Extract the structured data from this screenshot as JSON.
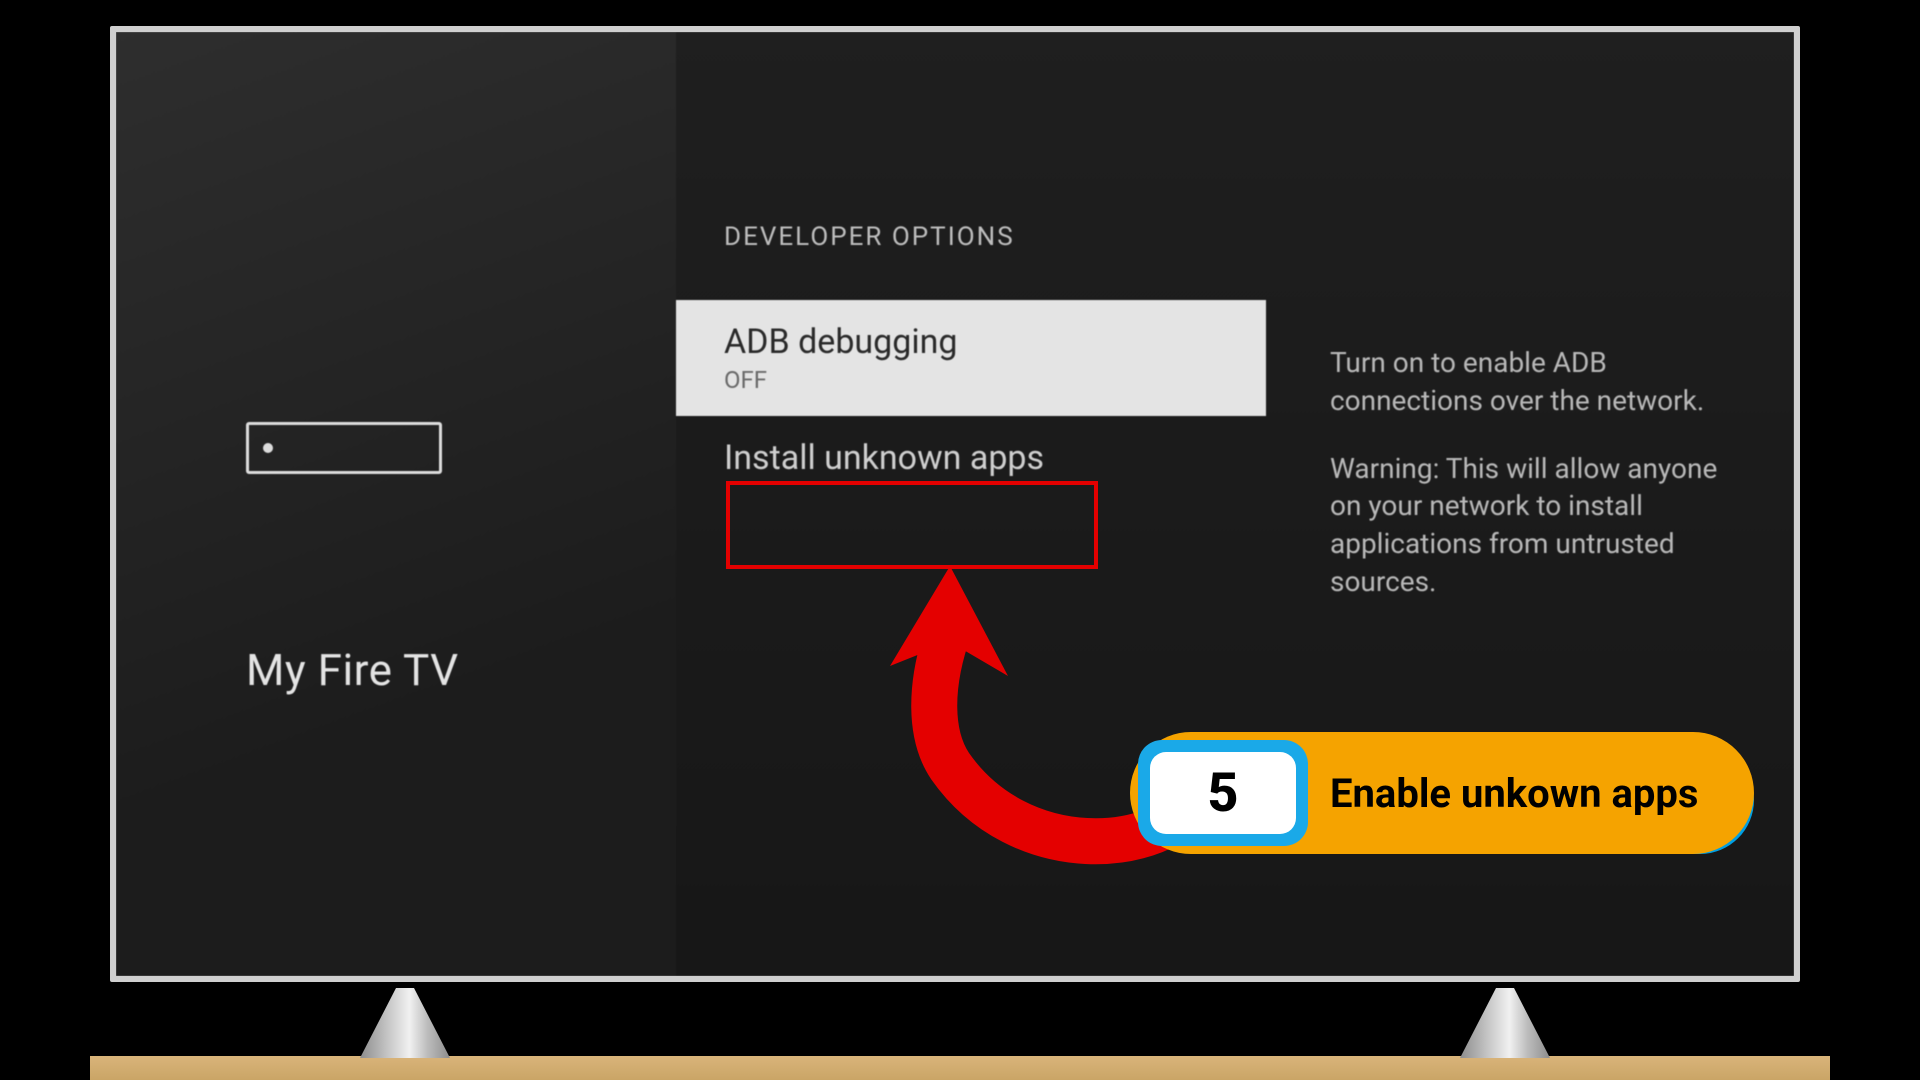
{
  "left": {
    "title": "My Fire TV"
  },
  "mid": {
    "header": "DEVELOPER OPTIONS",
    "options": [
      {
        "label": "ADB debugging",
        "sub": "OFF",
        "selected": true
      },
      {
        "label": "Install unknown apps",
        "sub": "",
        "selected": false
      }
    ]
  },
  "right": {
    "p1": "Turn on to enable ADB connections over the network.",
    "p2": "Warning: This will allow anyone on your network to install applications from untrusted sources."
  },
  "callout": {
    "step": "5",
    "text": "Enable unkown apps"
  },
  "colors": {
    "highlight": "#e40000",
    "callout_bg": "#f5a300",
    "callout_accent": "#1aa9e8"
  }
}
